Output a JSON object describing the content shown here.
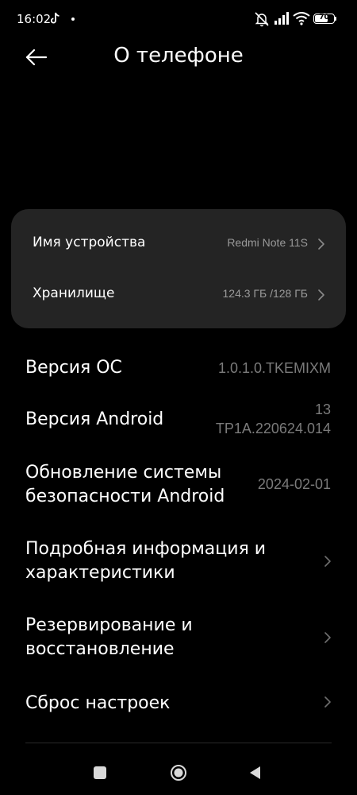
{
  "status_bar": {
    "time": "16:02",
    "battery_level": "70",
    "icons": [
      "tiktok-icon",
      "notification-dot-icon",
      "mute-icon",
      "signal-icon",
      "wifi-icon",
      "battery-icon"
    ]
  },
  "header": {
    "title": "О телефоне",
    "back_icon": "back-arrow-icon"
  },
  "card": {
    "rows": [
      {
        "label": "Имя устройства",
        "value": "Redmi Note 11S"
      },
      {
        "label": "Хранилище",
        "value": "124.3 ГБ /128 ГБ"
      }
    ]
  },
  "items": {
    "os_version": {
      "label": "Версия ОС",
      "value": "1.0.1.0.TKEMIXM"
    },
    "android_version": {
      "label": "Версия Android",
      "value_line1": "13",
      "value_line2": "TP1A.220624.014"
    },
    "security_update": {
      "label_line1": "Обновление системы",
      "label_line2": "безопасности Android",
      "value": "2024-02-01"
    },
    "details": {
      "label_line1": "Подробная информация и",
      "label_line2": "характеристики"
    },
    "backup": {
      "label_line1": "Резервирование и",
      "label_line2": "восстановление"
    },
    "reset": {
      "label": "Сброс настроек"
    }
  },
  "nav_bar": {
    "icons": [
      "recents-icon",
      "home-icon",
      "back-icon"
    ]
  },
  "colors": {
    "background": "#000000",
    "card": "#242424",
    "secondary_text": "#9a9a9a",
    "value_text": "#7b7b7b"
  }
}
